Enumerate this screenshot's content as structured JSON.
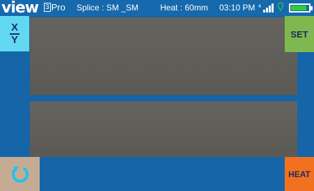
{
  "status_bar": {
    "logo": "view",
    "model_number": "3",
    "model_suffix": "Pro",
    "splice_mode": "Splice : SM _SM",
    "heat_info": "Heat : 60mm",
    "time": "03:10 PM",
    "battery_level": 0.9,
    "battery_color": "#2fcc3c"
  },
  "buttons": {
    "xy_top": "X",
    "xy_bottom": "Y",
    "set_label": "SET",
    "heat_label": "HEAT"
  },
  "icons": {
    "signal": "signal-icon",
    "pin": "location-pin-icon",
    "battery": "battery-icon",
    "rotate": "rotate-icon"
  },
  "colors": {
    "background": "#1565a8",
    "xy_button": "#62d9f0",
    "set_button": "#7fb84f",
    "rotate_button": "#c4ac92",
    "heat_button": "#f17120"
  }
}
